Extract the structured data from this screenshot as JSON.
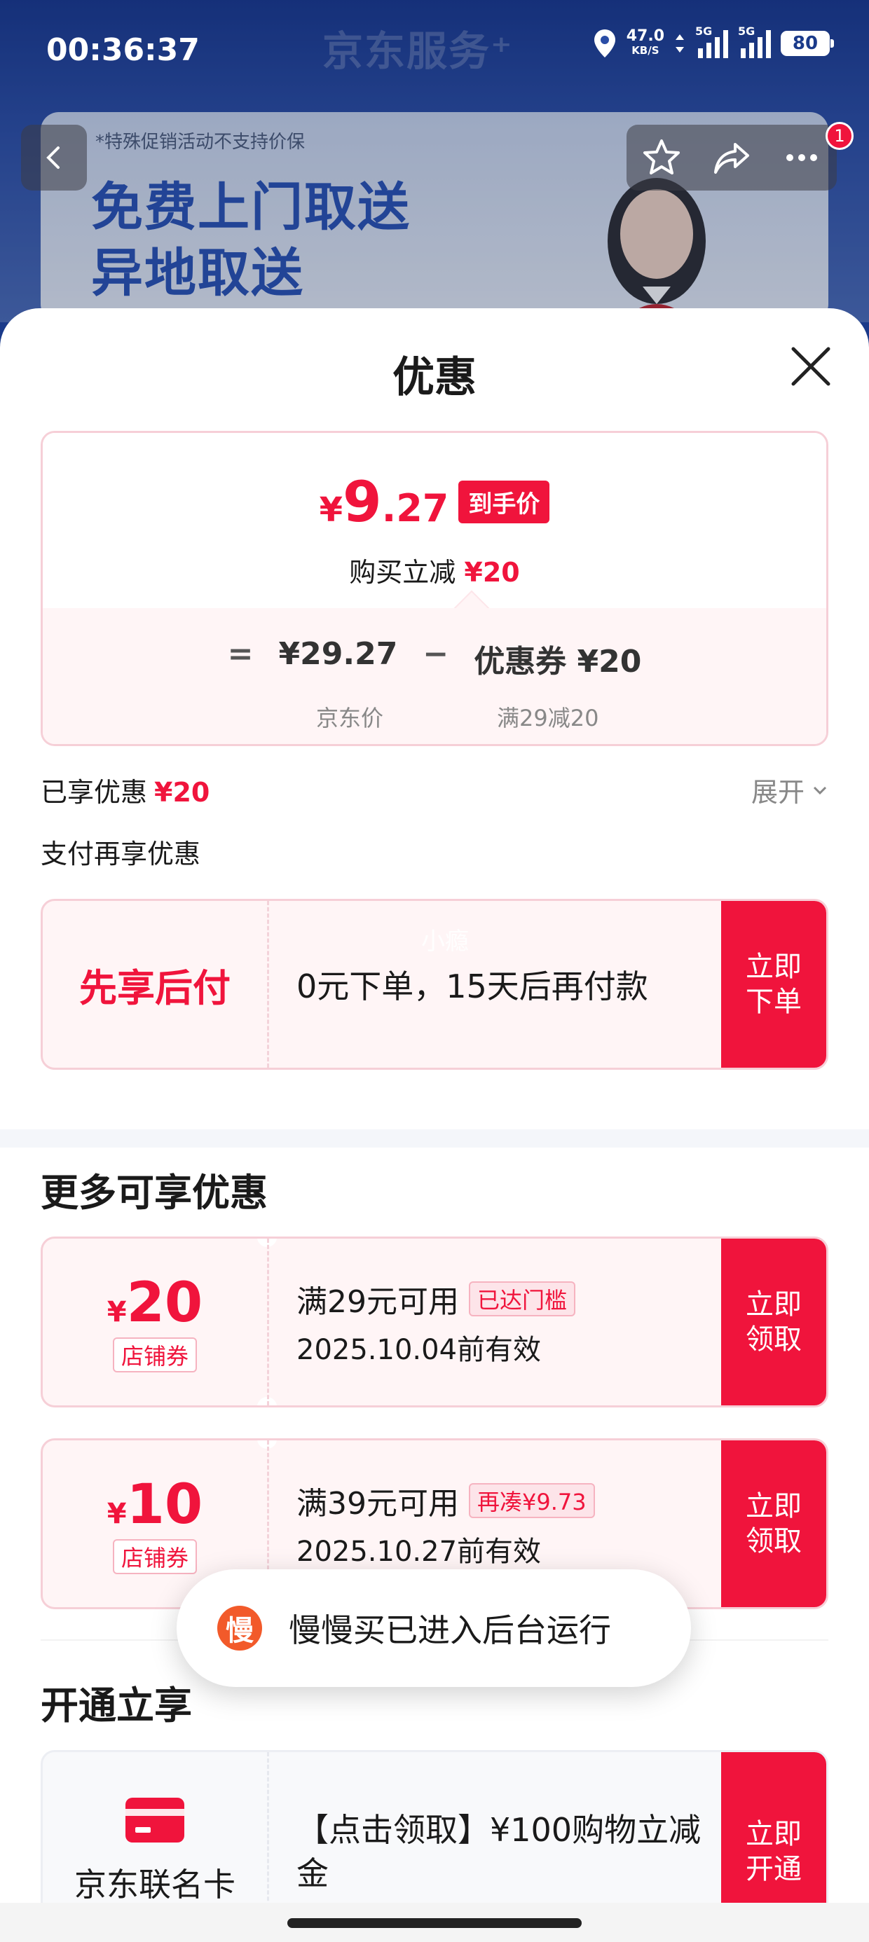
{
  "status_bar": {
    "time": "00:36:37",
    "net_speed": "47.0",
    "net_unit": "KB/S",
    "signal_label_1": "5G",
    "signal_label_2": "5G",
    "battery": "80"
  },
  "background": {
    "store_name": "京东服务⁺",
    "banner_note": "*特殊促销活动不支持价保",
    "banner_line1": "免费上门取送",
    "banner_line2": "异地取送",
    "cart_badge": "1"
  },
  "sheet": {
    "title": "优惠"
  },
  "price_card": {
    "currency": "¥",
    "price_int": "9",
    "price_dec": ".27",
    "price_tag": "到手价",
    "reduce_label": "购买立减",
    "reduce_amount": "¥20",
    "eq": "=",
    "base_price": "¥29.27",
    "minus": "−",
    "coupon_part": "优惠券 ¥20",
    "base_label": "京东价",
    "coupon_rule": "满29减20"
  },
  "enjoyed": {
    "label": "已享优惠",
    "amount": "¥20",
    "expand": "展开"
  },
  "pay_section": {
    "title": "支付再享优惠",
    "bnpl_title": "先享后付",
    "bnpl_text": "0元下单，15天后再付款",
    "bnpl_watermark": "小瘾",
    "bnpl_button": "立即下单"
  },
  "more": {
    "title": "更多可享优惠",
    "coupons": [
      {
        "currency": "¥",
        "amount": "20",
        "type": "店铺券",
        "rule": "满29元可用",
        "badge": "已达门槛",
        "valid": "2025.10.04前有效",
        "button": "立即领取"
      },
      {
        "currency": "¥",
        "amount": "10",
        "type": "店铺券",
        "rule": "满39元可用",
        "badge": "再凑¥9.73",
        "valid": "2025.10.27前有效",
        "button": "立即领取"
      }
    ]
  },
  "open_section": {
    "title": "开通立享",
    "card_name": "京东联名卡",
    "card_text": "【点击领取】¥100购物立减金",
    "button": "立即开通"
  },
  "toast": {
    "icon_char": "慢",
    "text": "慢慢买已进入后台运行"
  },
  "colors": {
    "accent": "#f0143c",
    "card_bg": "#fff5f6",
    "border": "#f6cfd7"
  }
}
